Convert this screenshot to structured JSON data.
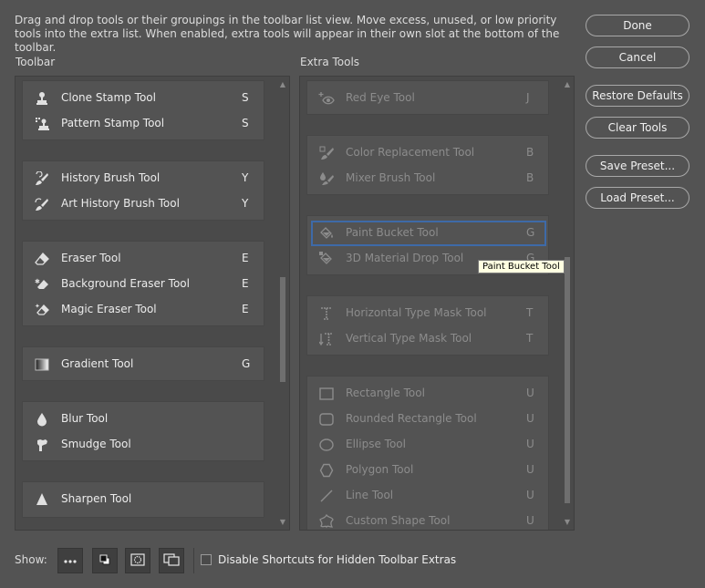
{
  "description": "Drag and drop tools or their groupings in the toolbar list view. Move excess, unused, or low priority tools into the extra list. When enabled, extra tools will appear in their own slot at the bottom of the toolbar.",
  "toolbar_title": "Toolbar",
  "extra_title": "Extra Tools",
  "buttons": {
    "done": "Done",
    "cancel": "Cancel",
    "restore": "Restore Defaults",
    "clear": "Clear Tools",
    "save_preset": "Save Preset...",
    "load_preset": "Load Preset..."
  },
  "toolbar_groups": [
    {
      "tools": [
        {
          "label": "Clone Stamp Tool",
          "key": "S",
          "icon": "clone-stamp-icon"
        },
        {
          "label": "Pattern Stamp Tool",
          "key": "S",
          "icon": "pattern-stamp-icon"
        }
      ]
    },
    {
      "tools": [
        {
          "label": "History Brush Tool",
          "key": "Y",
          "icon": "history-brush-icon"
        },
        {
          "label": "Art History Brush Tool",
          "key": "Y",
          "icon": "art-history-brush-icon"
        }
      ]
    },
    {
      "tools": [
        {
          "label": "Eraser Tool",
          "key": "E",
          "icon": "eraser-icon"
        },
        {
          "label": "Background Eraser Tool",
          "key": "E",
          "icon": "background-eraser-icon"
        },
        {
          "label": "Magic Eraser Tool",
          "key": "E",
          "icon": "magic-eraser-icon"
        }
      ]
    },
    {
      "tools": [
        {
          "label": "Gradient Tool",
          "key": "G",
          "icon": "gradient-icon"
        }
      ]
    },
    {
      "tools": [
        {
          "label": "Blur Tool",
          "key": "",
          "icon": "blur-icon"
        },
        {
          "label": "Smudge Tool",
          "key": "",
          "icon": "smudge-icon"
        }
      ]
    },
    {
      "tools": [
        {
          "label": "Sharpen Tool",
          "key": "",
          "icon": "sharpen-icon"
        }
      ]
    }
  ],
  "extra_groups": [
    {
      "tools": [
        {
          "label": "Red Eye Tool",
          "key": "J",
          "icon": "red-eye-icon"
        }
      ]
    },
    {
      "tools": [
        {
          "label": "Color Replacement Tool",
          "key": "B",
          "icon": "color-replacement-icon"
        },
        {
          "label": "Mixer Brush Tool",
          "key": "B",
          "icon": "mixer-brush-icon"
        }
      ]
    },
    {
      "tools": [
        {
          "label": "Paint Bucket Tool",
          "key": "G",
          "icon": "paint-bucket-icon",
          "selected": true
        },
        {
          "label": "3D Material Drop Tool",
          "key": "G",
          "icon": "3d-material-drop-icon"
        }
      ]
    },
    {
      "tools": [
        {
          "label": "Horizontal Type Mask Tool",
          "key": "T",
          "icon": "horizontal-type-mask-icon"
        },
        {
          "label": "Vertical Type Mask Tool",
          "key": "T",
          "icon": "vertical-type-mask-icon"
        }
      ]
    },
    {
      "tools": [
        {
          "label": "Rectangle Tool",
          "key": "U",
          "icon": "rectangle-icon"
        },
        {
          "label": "Rounded Rectangle Tool",
          "key": "U",
          "icon": "rounded-rectangle-icon"
        },
        {
          "label": "Ellipse Tool",
          "key": "U",
          "icon": "ellipse-icon"
        },
        {
          "label": "Polygon Tool",
          "key": "U",
          "icon": "polygon-icon"
        },
        {
          "label": "Line Tool",
          "key": "U",
          "icon": "line-icon"
        },
        {
          "label": "Custom Shape Tool",
          "key": "U",
          "icon": "custom-shape-icon"
        }
      ]
    }
  ],
  "tooltip": "Paint Bucket Tool",
  "footer": {
    "show_label": "Show:",
    "show_buttons": [
      "more-tools-icon",
      "default-colors-icon",
      "quick-mask-icon",
      "screen-mode-icon"
    ],
    "checkbox_label": "Disable Shortcuts for Hidden Toolbar Extras",
    "checkbox_checked": false
  }
}
